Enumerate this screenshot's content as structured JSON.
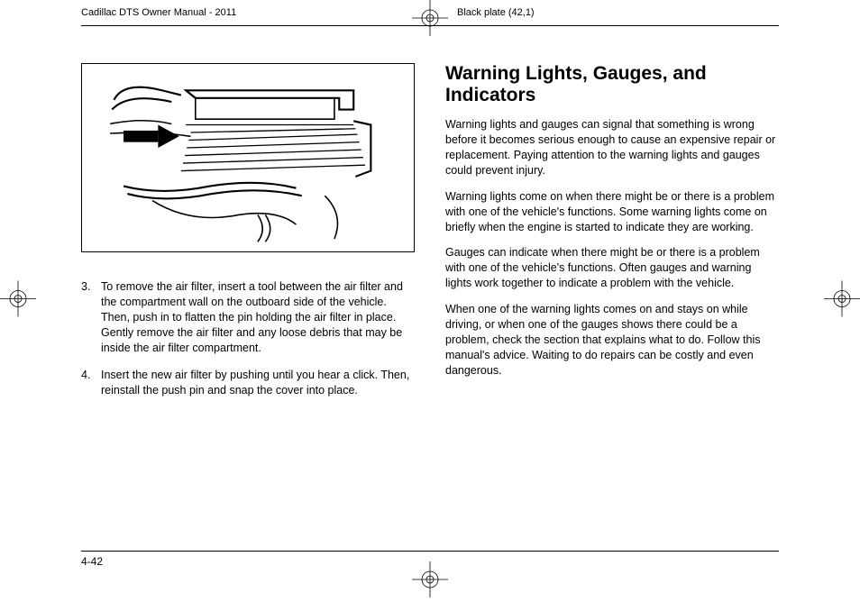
{
  "header": {
    "left": "Cadillac DTS Owner Manual - 2011",
    "right": "Black plate (42,1)"
  },
  "left_column": {
    "list": [
      {
        "num": "3.",
        "text": "To remove the air filter, insert a tool between the air filter and the compartment wall on the outboard side of the vehicle. Then, push in to flatten the pin holding the air filter in place. Gently remove the air filter and any loose debris that may be inside the air filter compartment."
      },
      {
        "num": "4.",
        "text": "Insert the new air filter by pushing until you hear a click. Then, reinstall the push pin and snap the cover into place."
      }
    ]
  },
  "right_column": {
    "title": "Warning Lights, Gauges, and Indicators",
    "paragraphs": [
      "Warning lights and gauges can signal that something is wrong before it becomes serious enough to cause an expensive repair or replacement. Paying attention to the warning lights and gauges could prevent injury.",
      "Warning lights come on when there might be or there is a problem with one of the vehicle's functions. Some warning lights come on briefly when the engine is started to indicate they are working.",
      "Gauges can indicate when there might be or there is a problem with one of the vehicle's functions. Often gauges and warning lights work together to indicate a problem with the vehicle.",
      "When one of the warning lights comes on and stays on while driving, or when one of the gauges shows there could be a problem, check the section that explains what to do. Follow this manual's advice. Waiting to do repairs can be costly and even dangerous."
    ]
  },
  "page_number": "4-42"
}
